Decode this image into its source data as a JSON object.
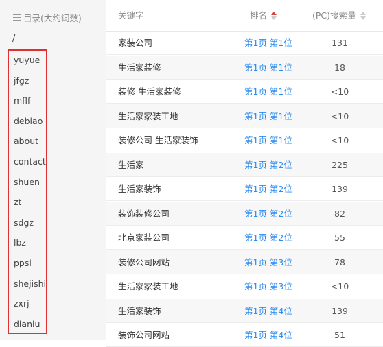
{
  "sidebar": {
    "header": "目录(大约词数)",
    "root": "/",
    "items": [
      "yuyue",
      "jfgz",
      "mflf",
      "debiao",
      "about",
      "contact",
      "shuen",
      "zt",
      "sdgz",
      "lbz",
      "ppsl",
      "shejishi",
      "zxrj",
      "dianlu"
    ]
  },
  "table": {
    "headers": {
      "keyword": "关键字",
      "rank": "排名",
      "search": "(PC)搜索量"
    },
    "rows": [
      {
        "keyword": "家装公司",
        "rank": "第1页 第1位",
        "search": "131"
      },
      {
        "keyword": "生活家装修",
        "rank": "第1页 第1位",
        "search": "18"
      },
      {
        "keyword": "装修 生活家装修",
        "rank": "第1页 第1位",
        "search": "<10"
      },
      {
        "keyword": "生活家家装工地",
        "rank": "第1页 第1位",
        "search": "<10"
      },
      {
        "keyword": "装修公司 生活家装饰",
        "rank": "第1页 第1位",
        "search": "<10"
      },
      {
        "keyword": "生活家",
        "rank": "第1页 第2位",
        "search": "225"
      },
      {
        "keyword": "生活家装饰",
        "rank": "第1页 第2位",
        "search": "139"
      },
      {
        "keyword": "装饰装修公司",
        "rank": "第1页 第2位",
        "search": "82"
      },
      {
        "keyword": "北京家装公司",
        "rank": "第1页 第2位",
        "search": "55"
      },
      {
        "keyword": "装修公司网站",
        "rank": "第1页 第3位",
        "search": "78"
      },
      {
        "keyword": "生活家家装工地",
        "rank": "第1页 第3位",
        "search": "<10"
      },
      {
        "keyword": "生活家装饰",
        "rank": "第1页 第4位",
        "search": "139"
      },
      {
        "keyword": "装饰公司网站",
        "rank": "第1页 第4位",
        "search": "51"
      }
    ]
  }
}
